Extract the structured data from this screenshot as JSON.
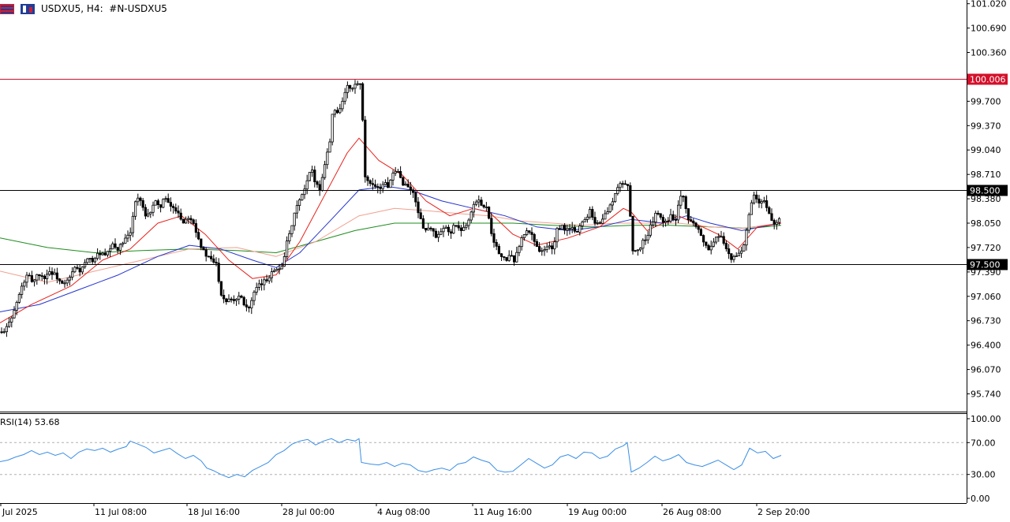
{
  "header": {
    "symbol": "USDXU5",
    "timeframe": "H4:",
    "description": "#N-USDXU5",
    "menu_icon": "chart-menu-icon",
    "type_icon": "candlestick-icon"
  },
  "colors": {
    "background": "#ffffff",
    "candle": "#000000",
    "ma_fast": "#e8201a",
    "ma_mid": "#2233cc",
    "ma_slow_light": "#f0a090",
    "ma_long": "#1e8c1e",
    "rsi_line": "#3a8ee6",
    "resistance_line": "#c8102e",
    "sr_line": "#000000",
    "price_tag_red": "#d4102a",
    "price_tag_black": "#000000"
  },
  "price_axis": {
    "ticks": [
      "101.020",
      "100.690",
      "100.360",
      "100.006",
      "99.700",
      "99.370",
      "99.040",
      "98.710",
      "98.500",
      "98.380",
      "98.050",
      "97.720",
      "97.500",
      "97.390",
      "97.060",
      "96.730",
      "96.400",
      "96.070",
      "95.740"
    ],
    "ymin": 95.5,
    "ymax": 101.07
  },
  "levels": [
    {
      "value": 100.006,
      "label": "100.006",
      "style": "red"
    },
    {
      "value": 98.5,
      "label": "98.500",
      "style": "black"
    },
    {
      "value": 97.5,
      "label": "97.500",
      "style": "black"
    }
  ],
  "time_axis": {
    "labels": [
      "Jul 2025",
      "11 Jul 08:00",
      "18 Jul 16:00",
      "28 Jul 00:00",
      "4 Aug 08:00",
      "11 Aug 16:00",
      "19 Aug 00:00",
      "26 Aug 08:00",
      "2 Sep 20:00"
    ]
  },
  "rsi": {
    "label": "RSI(14) 53.68",
    "ticks": [
      "100.00",
      "70.00",
      "30.00",
      "0.00"
    ],
    "levels": [
      70,
      30
    ]
  },
  "chart_data": {
    "type": "candlestick",
    "symbol": "USDXU5",
    "timeframe": "H4",
    "close_path": [
      [
        0,
        96.58
      ],
      [
        4,
        96.55
      ],
      [
        8,
        96.62
      ],
      [
        12,
        96.75
      ],
      [
        16,
        96.8
      ],
      [
        22,
        97.0
      ],
      [
        28,
        97.2
      ],
      [
        35,
        97.35
      ],
      [
        42,
        97.25
      ],
      [
        48,
        97.38
      ],
      [
        55,
        97.3
      ],
      [
        62,
        97.4
      ],
      [
        70,
        97.35
      ],
      [
        80,
        97.2
      ],
      [
        88,
        97.3
      ],
      [
        95,
        97.45
      ],
      [
        102,
        97.4
      ],
      [
        110,
        97.55
      ],
      [
        118,
        97.55
      ],
      [
        126,
        97.65
      ],
      [
        134,
        97.6
      ],
      [
        142,
        97.75
      ],
      [
        150,
        97.7
      ],
      [
        158,
        97.82
      ],
      [
        165,
        97.9
      ],
      [
        170,
        98.3
      ],
      [
        175,
        98.4
      ],
      [
        180,
        98.3
      ],
      [
        185,
        98.1
      ],
      [
        190,
        98.2
      ],
      [
        196,
        98.35
      ],
      [
        202,
        98.25
      ],
      [
        208,
        98.4
      ],
      [
        214,
        98.3
      ],
      [
        220,
        98.25
      ],
      [
        226,
        98.2
      ],
      [
        232,
        98.05
      ],
      [
        238,
        98.15
      ],
      [
        244,
        98.1
      ],
      [
        250,
        97.9
      ],
      [
        256,
        97.7
      ],
      [
        262,
        97.6
      ],
      [
        268,
        97.55
      ],
      [
        274,
        97.5
      ],
      [
        280,
        97.1
      ],
      [
        286,
        97.0
      ],
      [
        292,
        97.05
      ],
      [
        298,
        97.0
      ],
      [
        304,
        97.1
      ],
      [
        310,
        96.95
      ],
      [
        316,
        96.9
      ],
      [
        322,
        97.1
      ],
      [
        328,
        97.2
      ],
      [
        334,
        97.25
      ],
      [
        340,
        97.3
      ],
      [
        346,
        97.45
      ],
      [
        352,
        97.4
      ],
      [
        358,
        97.5
      ],
      [
        364,
        97.8
      ],
      [
        370,
        98.0
      ],
      [
        376,
        98.3
      ],
      [
        382,
        98.4
      ],
      [
        388,
        98.55
      ],
      [
        394,
        98.8
      ],
      [
        400,
        98.6
      ],
      [
        406,
        98.5
      ],
      [
        412,
        98.9
      ],
      [
        418,
        99.15
      ],
      [
        422,
        99.6
      ],
      [
        428,
        99.55
      ],
      [
        434,
        99.7
      ],
      [
        440,
        99.9
      ],
      [
        446,
        99.85
      ],
      [
        452,
        99.95
      ],
      [
        458,
        99.9
      ],
      [
        462,
        98.7
      ],
      [
        468,
        98.55
      ],
      [
        474,
        98.6
      ],
      [
        480,
        98.5
      ],
      [
        486,
        98.6
      ],
      [
        492,
        98.55
      ],
      [
        498,
        98.7
      ],
      [
        504,
        98.75
      ],
      [
        510,
        98.6
      ],
      [
        516,
        98.55
      ],
      [
        522,
        98.5
      ],
      [
        528,
        98.3
      ],
      [
        534,
        98.05
      ],
      [
        540,
        97.95
      ],
      [
        546,
        98.0
      ],
      [
        552,
        97.85
      ],
      [
        558,
        97.9
      ],
      [
        564,
        98.0
      ],
      [
        570,
        97.9
      ],
      [
        576,
        98.05
      ],
      [
        582,
        97.95
      ],
      [
        588,
        98.0
      ],
      [
        594,
        98.1
      ],
      [
        600,
        98.3
      ],
      [
        606,
        98.35
      ],
      [
        612,
        98.3
      ],
      [
        618,
        98.25
      ],
      [
        622,
        97.95
      ],
      [
        628,
        97.75
      ],
      [
        634,
        97.6
      ],
      [
        640,
        97.55
      ],
      [
        646,
        97.6
      ],
      [
        652,
        97.55
      ],
      [
        658,
        97.75
      ],
      [
        664,
        97.9
      ],
      [
        670,
        97.95
      ],
      [
        676,
        97.85
      ],
      [
        682,
        97.7
      ],
      [
        688,
        97.65
      ],
      [
        694,
        97.75
      ],
      [
        700,
        97.7
      ],
      [
        706,
        97.95
      ],
      [
        712,
        98.0
      ],
      [
        718,
        97.95
      ],
      [
        724,
        98.0
      ],
      [
        730,
        97.9
      ],
      [
        736,
        98.05
      ],
      [
        742,
        98.1
      ],
      [
        748,
        98.25
      ],
      [
        754,
        98.05
      ],
      [
        760,
        98.05
      ],
      [
        766,
        98.15
      ],
      [
        772,
        98.25
      ],
      [
        778,
        98.4
      ],
      [
        784,
        98.55
      ],
      [
        790,
        98.6
      ],
      [
        796,
        98.55
      ],
      [
        802,
        97.7
      ],
      [
        808,
        97.65
      ],
      [
        814,
        97.8
      ],
      [
        820,
        97.85
      ],
      [
        826,
        98.05
      ],
      [
        832,
        98.2
      ],
      [
        838,
        98.1
      ],
      [
        844,
        98.05
      ],
      [
        850,
        98.15
      ],
      [
        856,
        98.1
      ],
      [
        862,
        98.45
      ],
      [
        868,
        98.35
      ],
      [
        872,
        98.1
      ],
      [
        878,
        98.05
      ],
      [
        884,
        98.0
      ],
      [
        890,
        97.85
      ],
      [
        896,
        97.7
      ],
      [
        902,
        97.75
      ],
      [
        908,
        97.85
      ],
      [
        914,
        97.9
      ],
      [
        920,
        97.7
      ],
      [
        926,
        97.55
      ],
      [
        932,
        97.6
      ],
      [
        938,
        97.65
      ],
      [
        944,
        97.8
      ],
      [
        950,
        98.2
      ],
      [
        956,
        98.45
      ],
      [
        962,
        98.3
      ],
      [
        968,
        98.35
      ],
      [
        974,
        98.2
      ],
      [
        980,
        98.05
      ],
      [
        986,
        98.1
      ],
      [
        990,
        98.15
      ]
    ],
    "ma_fast_path": [
      [
        0,
        96.7
      ],
      [
        40,
        96.95
      ],
      [
        90,
        97.2
      ],
      [
        130,
        97.55
      ],
      [
        165,
        97.7
      ],
      [
        200,
        98.05
      ],
      [
        230,
        98.15
      ],
      [
        260,
        97.9
      ],
      [
        290,
        97.55
      ],
      [
        320,
        97.3
      ],
      [
        350,
        97.35
      ],
      [
        380,
        97.8
      ],
      [
        410,
        98.4
      ],
      [
        440,
        99.0
      ],
      [
        455,
        99.2
      ],
      [
        480,
        98.9
      ],
      [
        510,
        98.7
      ],
      [
        540,
        98.35
      ],
      [
        570,
        98.15
      ],
      [
        600,
        98.25
      ],
      [
        620,
        98.2
      ],
      [
        650,
        97.9
      ],
      [
        680,
        97.75
      ],
      [
        720,
        97.85
      ],
      [
        760,
        98.0
      ],
      [
        790,
        98.25
      ],
      [
        800,
        98.2
      ],
      [
        820,
        97.95
      ],
      [
        860,
        98.15
      ],
      [
        880,
        98.05
      ],
      [
        910,
        97.9
      ],
      [
        935,
        97.7
      ],
      [
        960,
        98.0
      ],
      [
        990,
        98.05
      ]
    ],
    "ma_mid_path": [
      [
        0,
        96.85
      ],
      [
        50,
        96.95
      ],
      [
        100,
        97.15
      ],
      [
        150,
        97.35
      ],
      [
        200,
        97.6
      ],
      [
        240,
        97.75
      ],
      [
        280,
        97.7
      ],
      [
        320,
        97.55
      ],
      [
        350,
        97.45
      ],
      [
        380,
        97.65
      ],
      [
        420,
        98.1
      ],
      [
        455,
        98.5
      ],
      [
        490,
        98.55
      ],
      [
        520,
        98.5
      ],
      [
        560,
        98.35
      ],
      [
        600,
        98.25
      ],
      [
        640,
        98.15
      ],
      [
        680,
        98.0
      ],
      [
        720,
        97.95
      ],
      [
        760,
        98.0
      ],
      [
        800,
        98.1
      ],
      [
        840,
        98.05
      ],
      [
        870,
        98.15
      ],
      [
        900,
        98.05
      ],
      [
        940,
        97.95
      ],
      [
        990,
        98.05
      ]
    ],
    "ma_slow_light_path": [
      [
        0,
        97.4
      ],
      [
        60,
        97.25
      ],
      [
        120,
        97.4
      ],
      [
        180,
        97.55
      ],
      [
        240,
        97.7
      ],
      [
        300,
        97.72
      ],
      [
        350,
        97.6
      ],
      [
        400,
        97.8
      ],
      [
        455,
        98.15
      ],
      [
        500,
        98.25
      ],
      [
        540,
        98.22
      ],
      [
        580,
        98.18
      ],
      [
        620,
        98.15
      ],
      [
        660,
        98.08
      ],
      [
        700,
        98.05
      ],
      [
        740,
        98.02
      ],
      [
        780,
        98.05
      ],
      [
        820,
        98.05
      ],
      [
        860,
        98.05
      ],
      [
        900,
        98.0
      ],
      [
        940,
        97.98
      ],
      [
        990,
        98.05
      ]
    ],
    "ma_long_path": [
      [
        0,
        97.85
      ],
      [
        60,
        97.72
      ],
      [
        120,
        97.65
      ],
      [
        180,
        97.68
      ],
      [
        240,
        97.7
      ],
      [
        300,
        97.68
      ],
      [
        350,
        97.65
      ],
      [
        400,
        97.8
      ],
      [
        450,
        97.95
      ],
      [
        500,
        98.05
      ],
      [
        550,
        98.05
      ],
      [
        600,
        98.05
      ],
      [
        650,
        98.05
      ],
      [
        700,
        98.02
      ],
      [
        750,
        98.0
      ],
      [
        800,
        98.02
      ],
      [
        850,
        98.02
      ],
      [
        900,
        98.0
      ],
      [
        950,
        97.98
      ],
      [
        990,
        98.02
      ]
    ],
    "rsi_path": [
      [
        0,
        46
      ],
      [
        10,
        48
      ],
      [
        20,
        52
      ],
      [
        30,
        55
      ],
      [
        40,
        60
      ],
      [
        50,
        55
      ],
      [
        60,
        58
      ],
      [
        70,
        54
      ],
      [
        80,
        57
      ],
      [
        90,
        50
      ],
      [
        100,
        58
      ],
      [
        110,
        62
      ],
      [
        120,
        60
      ],
      [
        130,
        63
      ],
      [
        140,
        58
      ],
      [
        150,
        62
      ],
      [
        160,
        65
      ],
      [
        165,
        72
      ],
      [
        175,
        68
      ],
      [
        185,
        64
      ],
      [
        195,
        57
      ],
      [
        205,
        60
      ],
      [
        215,
        63
      ],
      [
        225,
        56
      ],
      [
        235,
        50
      ],
      [
        245,
        54
      ],
      [
        255,
        47
      ],
      [
        262,
        38
      ],
      [
        270,
        35
      ],
      [
        280,
        30
      ],
      [
        290,
        26
      ],
      [
        300,
        30
      ],
      [
        310,
        27
      ],
      [
        320,
        35
      ],
      [
        330,
        40
      ],
      [
        340,
        45
      ],
      [
        350,
        55
      ],
      [
        360,
        60
      ],
      [
        370,
        68
      ],
      [
        380,
        72
      ],
      [
        390,
        74
      ],
      [
        400,
        67
      ],
      [
        410,
        72
      ],
      [
        420,
        75
      ],
      [
        430,
        70
      ],
      [
        440,
        74
      ],
      [
        450,
        72
      ],
      [
        455,
        75
      ],
      [
        458,
        45
      ],
      [
        470,
        43
      ],
      [
        480,
        42
      ],
      [
        490,
        45
      ],
      [
        500,
        40
      ],
      [
        510,
        44
      ],
      [
        520,
        42
      ],
      [
        530,
        35
      ],
      [
        540,
        33
      ],
      [
        550,
        36
      ],
      [
        560,
        38
      ],
      [
        570,
        35
      ],
      [
        580,
        43
      ],
      [
        590,
        45
      ],
      [
        600,
        52
      ],
      [
        610,
        48
      ],
      [
        620,
        45
      ],
      [
        630,
        35
      ],
      [
        640,
        33
      ],
      [
        650,
        34
      ],
      [
        660,
        42
      ],
      [
        670,
        50
      ],
      [
        680,
        44
      ],
      [
        690,
        38
      ],
      [
        700,
        42
      ],
      [
        710,
        52
      ],
      [
        720,
        55
      ],
      [
        730,
        50
      ],
      [
        740,
        58
      ],
      [
        750,
        57
      ],
      [
        760,
        50
      ],
      [
        770,
        53
      ],
      [
        780,
        62
      ],
      [
        790,
        66
      ],
      [
        795,
        70
      ],
      [
        800,
        33
      ],
      [
        810,
        38
      ],
      [
        820,
        45
      ],
      [
        830,
        53
      ],
      [
        840,
        47
      ],
      [
        850,
        50
      ],
      [
        860,
        55
      ],
      [
        870,
        45
      ],
      [
        880,
        42
      ],
      [
        890,
        40
      ],
      [
        900,
        44
      ],
      [
        910,
        48
      ],
      [
        920,
        42
      ],
      [
        930,
        36
      ],
      [
        940,
        42
      ],
      [
        950,
        63
      ],
      [
        960,
        57
      ],
      [
        970,
        59
      ],
      [
        980,
        50
      ],
      [
        990,
        54
      ]
    ]
  }
}
